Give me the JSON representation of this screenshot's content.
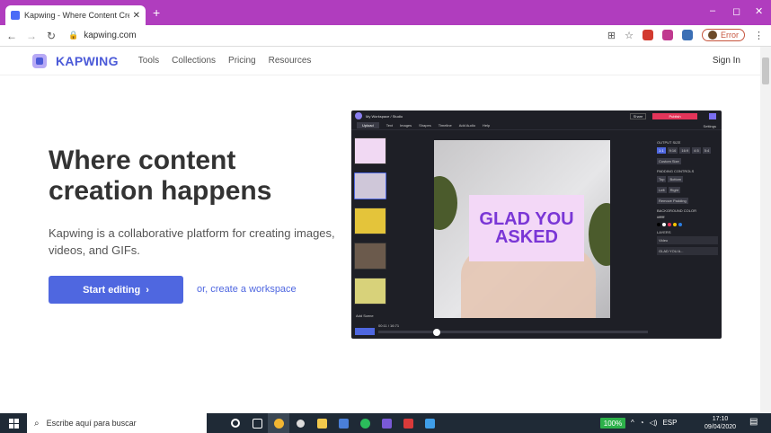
{
  "browser": {
    "tab_title": "Kapwing - Where Content Creati",
    "tab_close": "✕",
    "new_tab": "+",
    "url": "kapwing.com",
    "error_label": "Error",
    "controls": {
      "minimize": "–",
      "maximize": "◻",
      "close": "✕"
    }
  },
  "site": {
    "brand": "KAPWING",
    "nav": [
      "Tools",
      "Collections",
      "Pricing",
      "Resources"
    ],
    "signin": "Sign In"
  },
  "hero": {
    "title": "Where content creation happens",
    "subtitle": "Kapwing is a collaborative platform for creating images, videos, and GIFs.",
    "cta_label": "Start editing",
    "cta_arrow": "›",
    "workspace_link": "or, create a workspace"
  },
  "studio": {
    "breadcrumb": "My Workspace / Studio",
    "share": "Share",
    "publish": "Publish",
    "tools": [
      "Upload",
      "Text",
      "Images",
      "Shapes",
      "Timeline",
      "Add Audio",
      "Help"
    ],
    "settings": "Settings",
    "add_scene": "Add Scene",
    "canvas_text": "GLAD YOU ASKED",
    "timecode": "00:11 / 16:71",
    "right_panel": {
      "output_size": "OUTPUT SIZE",
      "ratios": [
        "1:1",
        "9:16",
        "16:9",
        "4:5",
        "5:4"
      ],
      "custom": "Custom Size",
      "padding": "PADDING CONTROLS",
      "pad_opts": [
        "Top",
        "Bottom",
        "Left",
        "Right"
      ],
      "remove_padding": "Remove Padding",
      "bg_color": "BACKGROUND COLOR",
      "bg_value": "#ffffff",
      "layers": "LAYERS",
      "layer_items": [
        "Video",
        "GLAD YOU A..."
      ]
    },
    "dot_colors": [
      "#000000",
      "#ffffff",
      "#e4355a",
      "#f5c400",
      "#2a7de1"
    ]
  },
  "taskbar": {
    "search_placeholder": "Escribe aquí para buscar",
    "battery": "100%",
    "lang": "ESP",
    "time": "17:10",
    "date": "09/04/2020"
  }
}
